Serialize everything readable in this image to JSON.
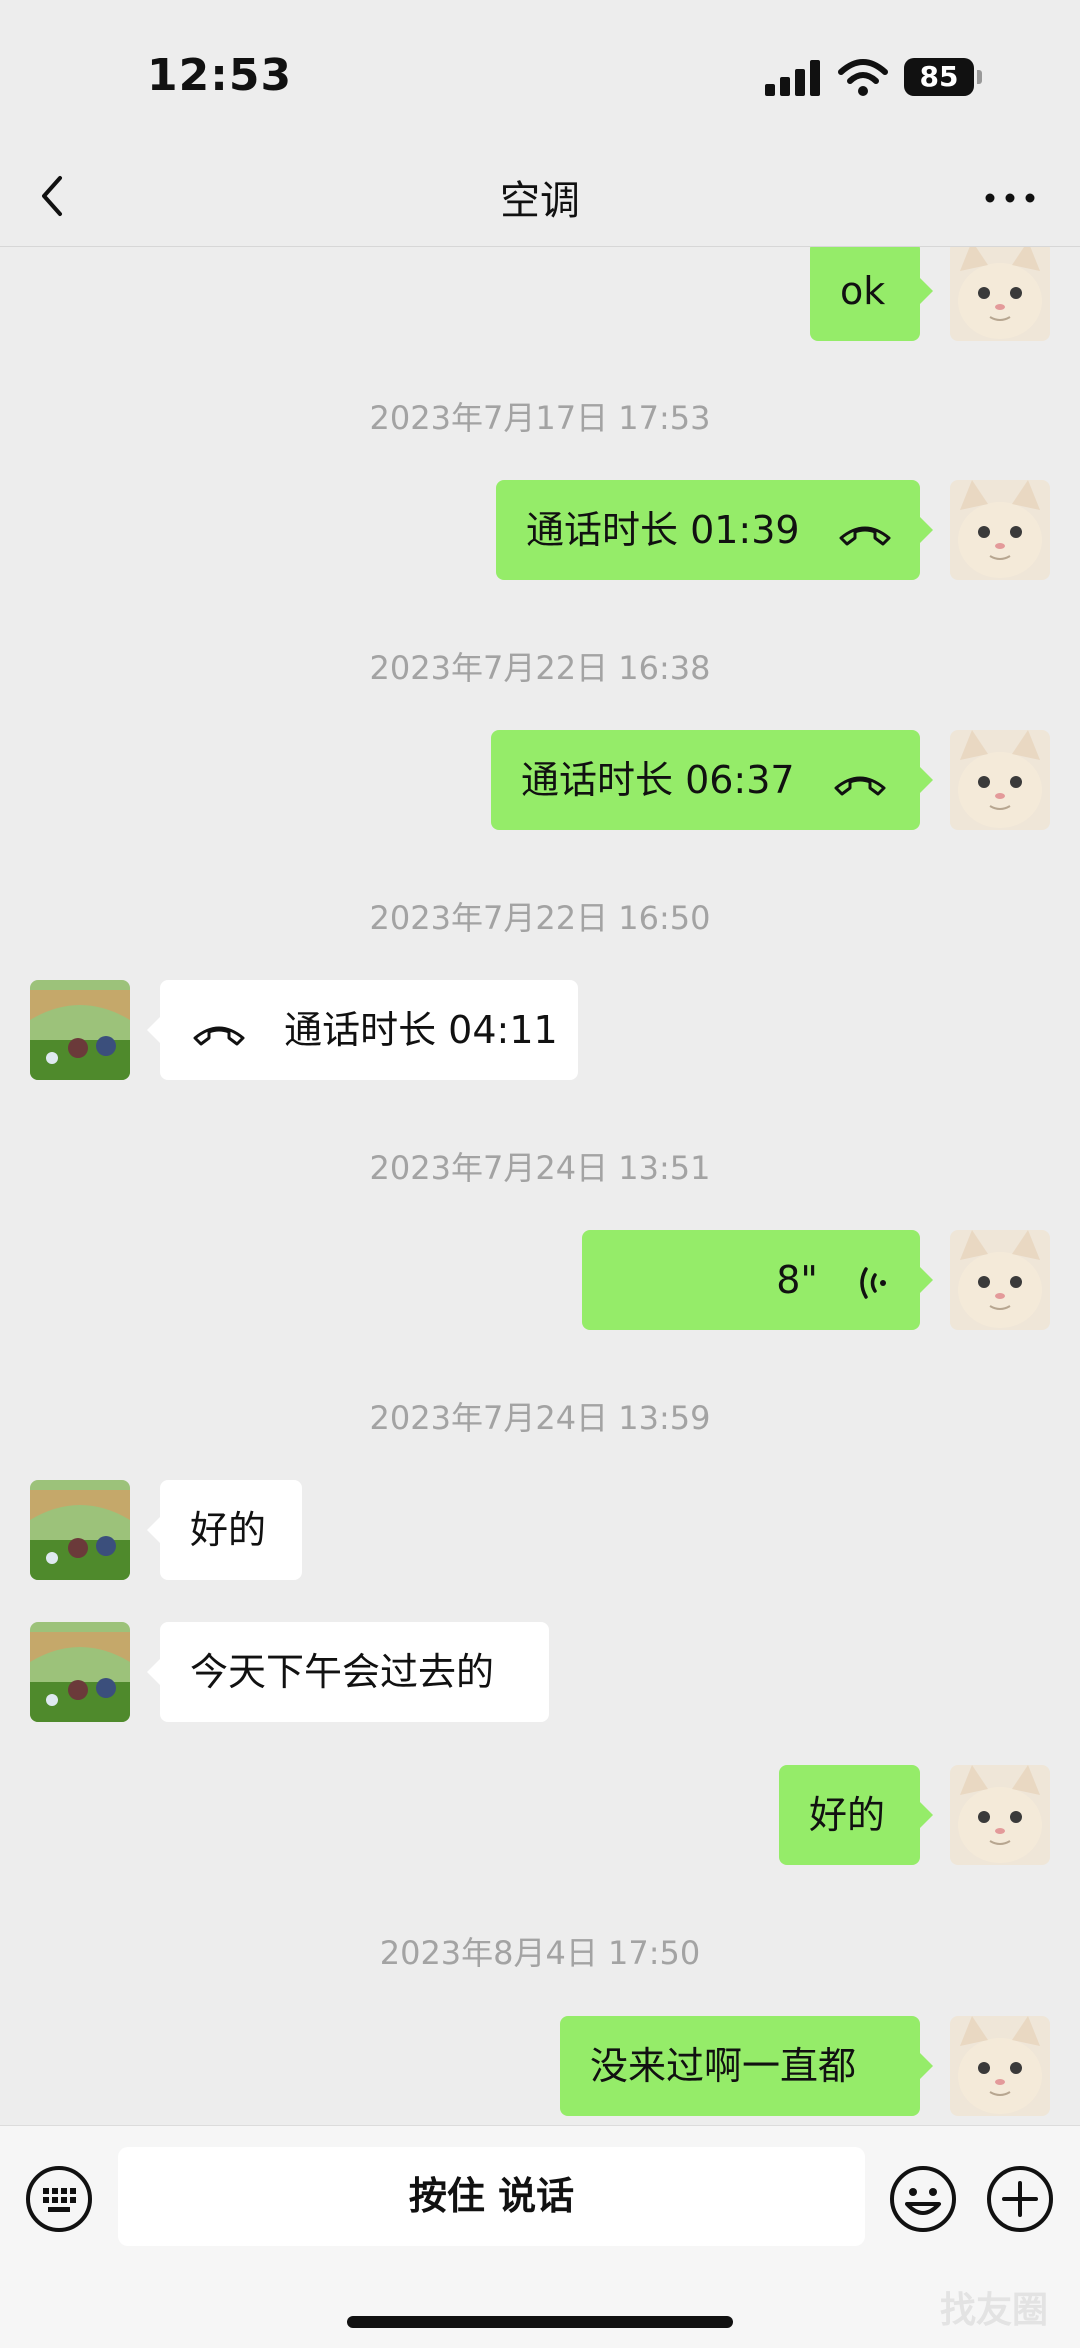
{
  "status_bar": {
    "time": "12:53",
    "battery": "85"
  },
  "nav": {
    "title": "空调"
  },
  "messages": [
    {
      "kind": "text",
      "sender": "me",
      "text": "ok"
    },
    {
      "kind": "timestamp",
      "text": "2023年7月17日 17:53"
    },
    {
      "kind": "call",
      "sender": "me",
      "text": "通话时长 01:39",
      "icon": "phone-hangup-icon"
    },
    {
      "kind": "timestamp",
      "text": "2023年7月22日 16:38"
    },
    {
      "kind": "call",
      "sender": "me",
      "text": "通话时长 06:37",
      "icon": "phone-hangup-icon"
    },
    {
      "kind": "timestamp",
      "text": "2023年7月22日 16:50"
    },
    {
      "kind": "call",
      "sender": "other",
      "text": "通话时长 04:11",
      "icon": "phone-hangup-icon"
    },
    {
      "kind": "timestamp",
      "text": "2023年7月24日 13:51"
    },
    {
      "kind": "voice",
      "sender": "me",
      "text": "8\"",
      "icon": "voice-wave-icon"
    },
    {
      "kind": "timestamp",
      "text": "2023年7月24日 13:59"
    },
    {
      "kind": "text",
      "sender": "other",
      "text": "好的"
    },
    {
      "kind": "text",
      "sender": "other",
      "text": "今天下午会过去的"
    },
    {
      "kind": "text",
      "sender": "me",
      "text": "好的"
    },
    {
      "kind": "timestamp",
      "text": "2023年8月4日 17:50"
    },
    {
      "kind": "text",
      "sender": "me",
      "text": "没来过啊一直都"
    }
  ],
  "input_bar": {
    "talk_label": "按住 说话"
  },
  "watermark": "找友圈",
  "colors": {
    "my_bubble": "#95ec69",
    "other_bubble": "#ffffff",
    "background": "#ededed",
    "timestamp": "#a3a3a3"
  },
  "icons": {
    "back": "chevron-left-icon",
    "more": "more-dots-icon",
    "keyboard": "voice-keyboard-icon",
    "emoji": "emoji-icon",
    "plus": "plus-icon"
  }
}
